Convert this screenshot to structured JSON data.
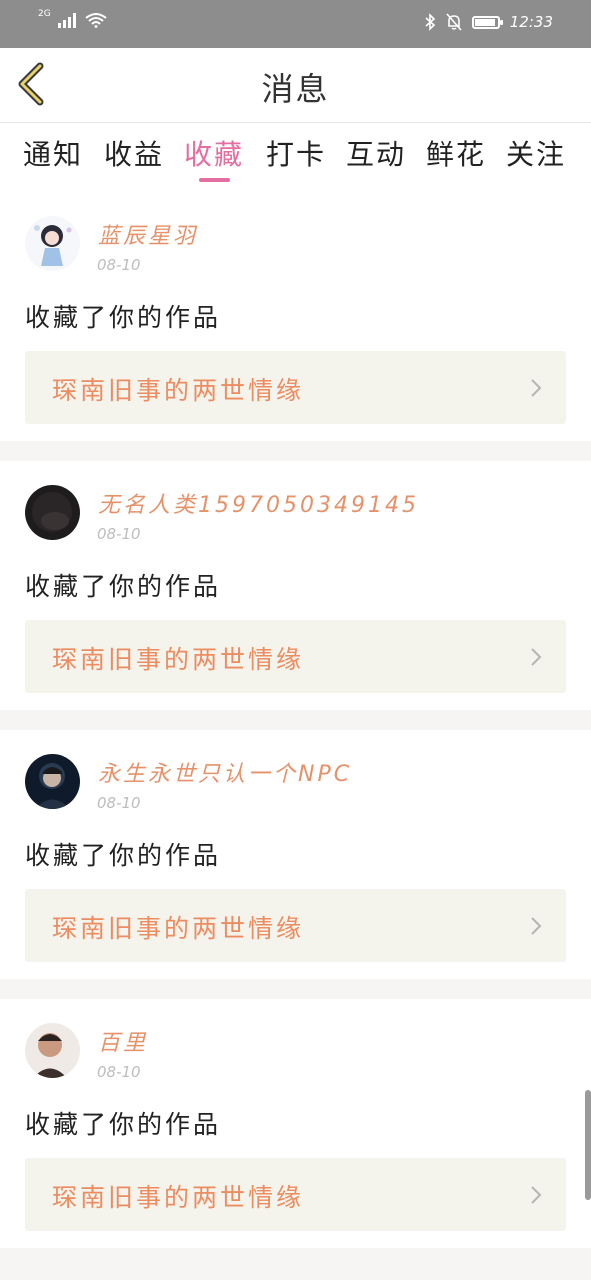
{
  "status_bar": {
    "network": "2G",
    "time": "12:33",
    "battery_level": 0.9
  },
  "header": {
    "title": "消息"
  },
  "tabs": [
    {
      "label": "通知",
      "active": false
    },
    {
      "label": "收益",
      "active": false
    },
    {
      "label": "收藏",
      "active": true
    },
    {
      "label": "打卡",
      "active": false
    },
    {
      "label": "互动",
      "active": false
    },
    {
      "label": "鲜花",
      "active": false
    },
    {
      "label": "关注",
      "active": false
    }
  ],
  "notifications": [
    {
      "user": "蓝辰星羽",
      "date": "08-10",
      "action": "收藏了你的作品",
      "work_title": "琛南旧事的两世情缘"
    },
    {
      "user": "无名人类1597050349145",
      "date": "08-10",
      "action": "收藏了你的作品",
      "work_title": "琛南旧事的两世情缘"
    },
    {
      "user": "永生永世只认一个NPC",
      "date": "08-10",
      "action": "收藏了你的作品",
      "work_title": "琛南旧事的两世情缘"
    },
    {
      "user": "百里",
      "date": "08-10",
      "action": "收藏了你的作品",
      "work_title": "琛南旧事的两世情缘"
    }
  ],
  "colors": {
    "accent_pink": "#e56ea1",
    "username_orange": "#e5926a",
    "work_title_orange": "#ec8c61",
    "work_bg": "#f4f3ec"
  }
}
